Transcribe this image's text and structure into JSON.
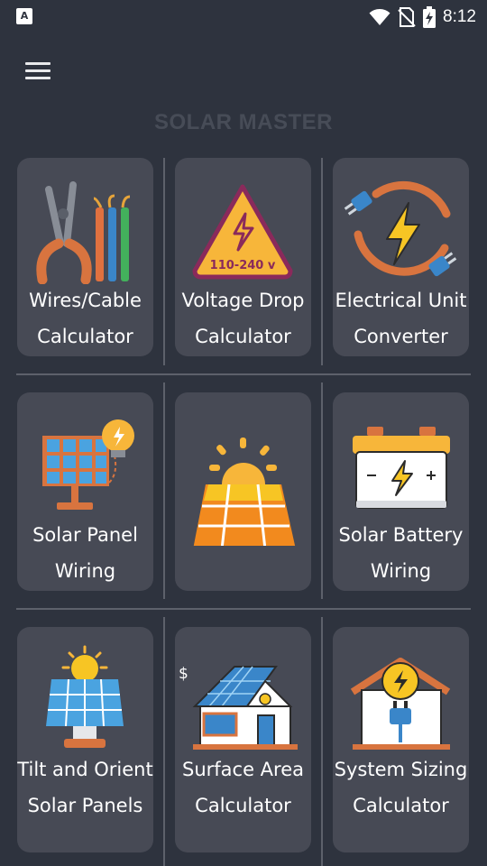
{
  "status_bar": {
    "notification_icon": "a-letter-icon",
    "time": "8:12",
    "icons": [
      "wifi-icon",
      "no-sim-icon",
      "battery-charging-icon"
    ]
  },
  "header": {
    "menu_icon": "hamburger-menu-icon",
    "title": "SOLAR MASTER"
  },
  "cards": [
    {
      "line1": "Wires/Cable",
      "line2": "Calculator",
      "icon": "pliers-wires-icon"
    },
    {
      "line1": "Voltage Drop",
      "line2": "Calculator",
      "icon": "voltage-warning-icon",
      "badge": "110-240 v"
    },
    {
      "line1": "Electrical Unit",
      "line2": "Converter",
      "icon": "plug-lightning-icon"
    },
    {
      "line1": "Solar Panel",
      "line2": "Wiring",
      "icon": "solar-panel-bulb-icon"
    },
    {
      "line1": "",
      "line2": "",
      "icon": "sunrise-solar-panel-icon"
    },
    {
      "line1": "Solar Battery",
      "line2": "Wiring",
      "icon": "battery-icon"
    },
    {
      "line1": "Tilt and Orient",
      "line2": "Solar Panels",
      "icon": "sun-solar-panel-icon"
    },
    {
      "line1": "Surface Area",
      "line2": "Calculator",
      "icon": "solar-house-icon",
      "badge": "$"
    },
    {
      "line1": "System Sizing",
      "line2": "Calculator",
      "icon": "house-plug-icon"
    }
  ],
  "colors": {
    "background": "#2e333e",
    "card": "#474a55",
    "title": "#474c57",
    "divider": "#5d616b"
  }
}
